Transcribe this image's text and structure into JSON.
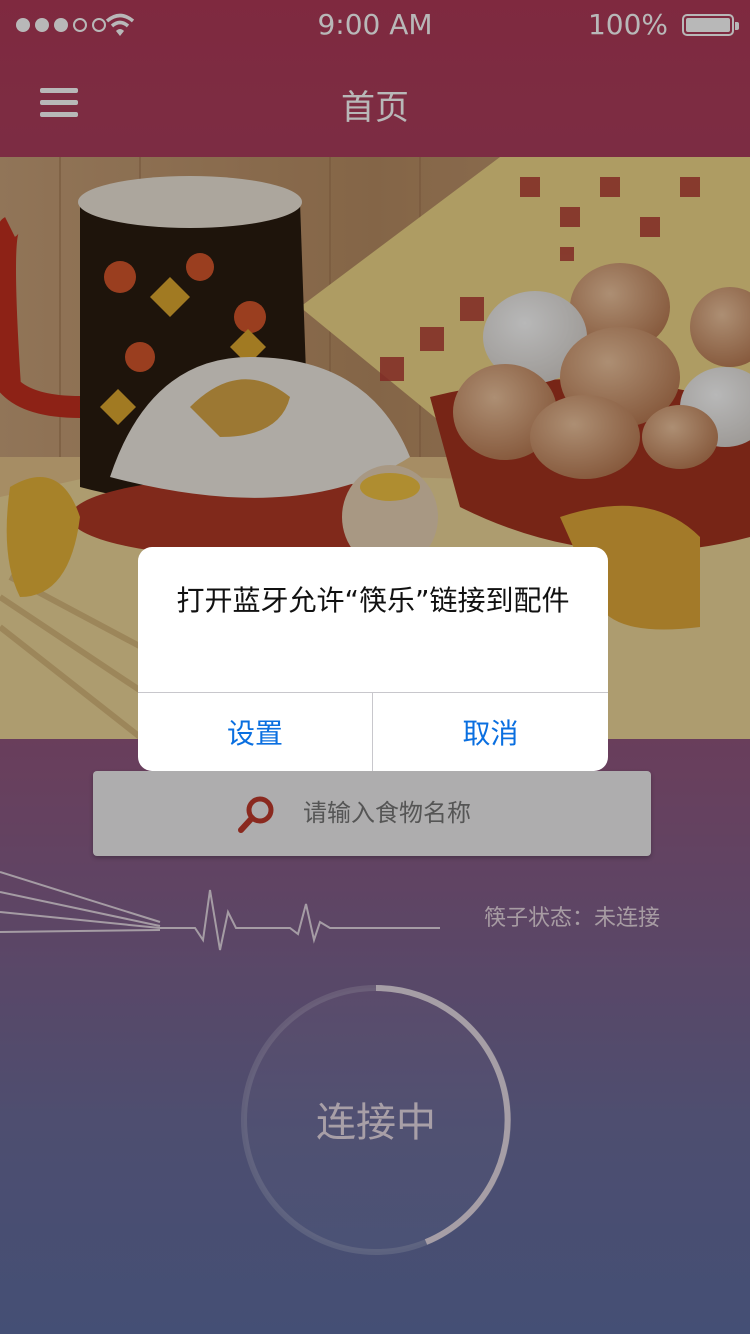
{
  "status_bar": {
    "time": "9:00 AM",
    "battery": "100%"
  },
  "nav": {
    "title": "首页",
    "menu_icon": "hamburger-menu-icon"
  },
  "hero": {
    "image": "breakfast-food-photo",
    "watermark": ""
  },
  "search": {
    "placeholder": "请输入食物名称",
    "icon": "search-icon"
  },
  "chopsticks_status": "筷子状态：未连接",
  "connect": {
    "label": "连接中"
  },
  "alert": {
    "message": "打开蓝牙允许“筷乐”链接到配件",
    "buttons": {
      "settings": "设置",
      "cancel": "取消"
    }
  },
  "colors": {
    "accent": "#0a6fe0",
    "header": "#b03a58",
    "bottom": "#5f6ea2"
  }
}
